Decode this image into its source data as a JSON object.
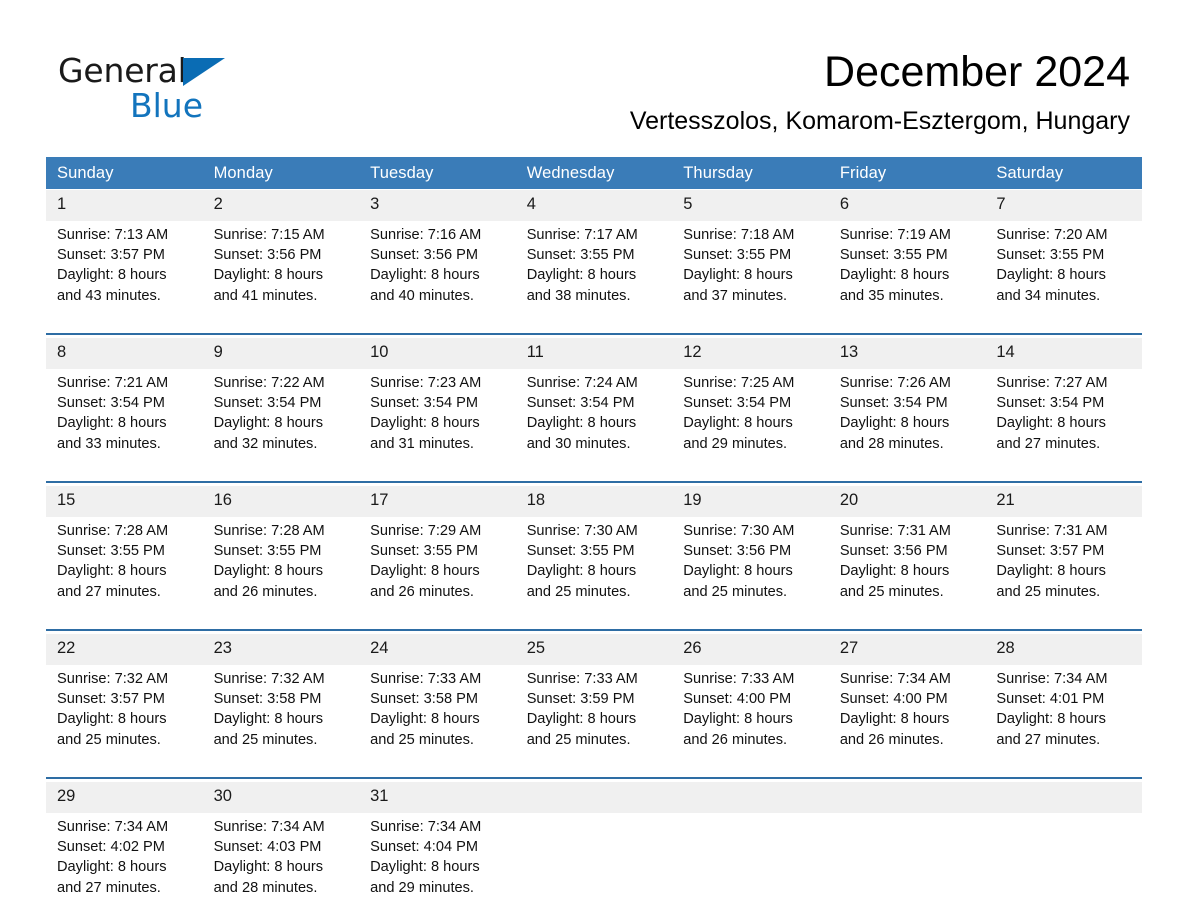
{
  "brand": {
    "name_part1": "General",
    "name_part2": "Blue",
    "triangle_color": "#0a6cb4",
    "blue_text_color": "#1274bd"
  },
  "header": {
    "title": "December 2024",
    "subtitle": "Vertesszolos, Komarom-Esztergom, Hungary"
  },
  "theme": {
    "header_blue": "#3a7cb8",
    "rule_blue": "#2e6da4",
    "daynum_band": "#f0f0f0"
  },
  "weekdays": [
    "Sunday",
    "Monday",
    "Tuesday",
    "Wednesday",
    "Thursday",
    "Friday",
    "Saturday"
  ],
  "weeks": [
    {
      "days": [
        {
          "num": "1",
          "sunrise": "Sunrise: 7:13 AM",
          "sunset": "Sunset: 3:57 PM",
          "daylight1": "Daylight: 8 hours",
          "daylight2": "and 43 minutes."
        },
        {
          "num": "2",
          "sunrise": "Sunrise: 7:15 AM",
          "sunset": "Sunset: 3:56 PM",
          "daylight1": "Daylight: 8 hours",
          "daylight2": "and 41 minutes."
        },
        {
          "num": "3",
          "sunrise": "Sunrise: 7:16 AM",
          "sunset": "Sunset: 3:56 PM",
          "daylight1": "Daylight: 8 hours",
          "daylight2": "and 40 minutes."
        },
        {
          "num": "4",
          "sunrise": "Sunrise: 7:17 AM",
          "sunset": "Sunset: 3:55 PM",
          "daylight1": "Daylight: 8 hours",
          "daylight2": "and 38 minutes."
        },
        {
          "num": "5",
          "sunrise": "Sunrise: 7:18 AM",
          "sunset": "Sunset: 3:55 PM",
          "daylight1": "Daylight: 8 hours",
          "daylight2": "and 37 minutes."
        },
        {
          "num": "6",
          "sunrise": "Sunrise: 7:19 AM",
          "sunset": "Sunset: 3:55 PM",
          "daylight1": "Daylight: 8 hours",
          "daylight2": "and 35 minutes."
        },
        {
          "num": "7",
          "sunrise": "Sunrise: 7:20 AM",
          "sunset": "Sunset: 3:55 PM",
          "daylight1": "Daylight: 8 hours",
          "daylight2": "and 34 minutes."
        }
      ]
    },
    {
      "days": [
        {
          "num": "8",
          "sunrise": "Sunrise: 7:21 AM",
          "sunset": "Sunset: 3:54 PM",
          "daylight1": "Daylight: 8 hours",
          "daylight2": "and 33 minutes."
        },
        {
          "num": "9",
          "sunrise": "Sunrise: 7:22 AM",
          "sunset": "Sunset: 3:54 PM",
          "daylight1": "Daylight: 8 hours",
          "daylight2": "and 32 minutes."
        },
        {
          "num": "10",
          "sunrise": "Sunrise: 7:23 AM",
          "sunset": "Sunset: 3:54 PM",
          "daylight1": "Daylight: 8 hours",
          "daylight2": "and 31 minutes."
        },
        {
          "num": "11",
          "sunrise": "Sunrise: 7:24 AM",
          "sunset": "Sunset: 3:54 PM",
          "daylight1": "Daylight: 8 hours",
          "daylight2": "and 30 minutes."
        },
        {
          "num": "12",
          "sunrise": "Sunrise: 7:25 AM",
          "sunset": "Sunset: 3:54 PM",
          "daylight1": "Daylight: 8 hours",
          "daylight2": "and 29 minutes."
        },
        {
          "num": "13",
          "sunrise": "Sunrise: 7:26 AM",
          "sunset": "Sunset: 3:54 PM",
          "daylight1": "Daylight: 8 hours",
          "daylight2": "and 28 minutes."
        },
        {
          "num": "14",
          "sunrise": "Sunrise: 7:27 AM",
          "sunset": "Sunset: 3:54 PM",
          "daylight1": "Daylight: 8 hours",
          "daylight2": "and 27 minutes."
        }
      ]
    },
    {
      "days": [
        {
          "num": "15",
          "sunrise": "Sunrise: 7:28 AM",
          "sunset": "Sunset: 3:55 PM",
          "daylight1": "Daylight: 8 hours",
          "daylight2": "and 27 minutes."
        },
        {
          "num": "16",
          "sunrise": "Sunrise: 7:28 AM",
          "sunset": "Sunset: 3:55 PM",
          "daylight1": "Daylight: 8 hours",
          "daylight2": "and 26 minutes."
        },
        {
          "num": "17",
          "sunrise": "Sunrise: 7:29 AM",
          "sunset": "Sunset: 3:55 PM",
          "daylight1": "Daylight: 8 hours",
          "daylight2": "and 26 minutes."
        },
        {
          "num": "18",
          "sunrise": "Sunrise: 7:30 AM",
          "sunset": "Sunset: 3:55 PM",
          "daylight1": "Daylight: 8 hours",
          "daylight2": "and 25 minutes."
        },
        {
          "num": "19",
          "sunrise": "Sunrise: 7:30 AM",
          "sunset": "Sunset: 3:56 PM",
          "daylight1": "Daylight: 8 hours",
          "daylight2": "and 25 minutes."
        },
        {
          "num": "20",
          "sunrise": "Sunrise: 7:31 AM",
          "sunset": "Sunset: 3:56 PM",
          "daylight1": "Daylight: 8 hours",
          "daylight2": "and 25 minutes."
        },
        {
          "num": "21",
          "sunrise": "Sunrise: 7:31 AM",
          "sunset": "Sunset: 3:57 PM",
          "daylight1": "Daylight: 8 hours",
          "daylight2": "and 25 minutes."
        }
      ]
    },
    {
      "days": [
        {
          "num": "22",
          "sunrise": "Sunrise: 7:32 AM",
          "sunset": "Sunset: 3:57 PM",
          "daylight1": "Daylight: 8 hours",
          "daylight2": "and 25 minutes."
        },
        {
          "num": "23",
          "sunrise": "Sunrise: 7:32 AM",
          "sunset": "Sunset: 3:58 PM",
          "daylight1": "Daylight: 8 hours",
          "daylight2": "and 25 minutes."
        },
        {
          "num": "24",
          "sunrise": "Sunrise: 7:33 AM",
          "sunset": "Sunset: 3:58 PM",
          "daylight1": "Daylight: 8 hours",
          "daylight2": "and 25 minutes."
        },
        {
          "num": "25",
          "sunrise": "Sunrise: 7:33 AM",
          "sunset": "Sunset: 3:59 PM",
          "daylight1": "Daylight: 8 hours",
          "daylight2": "and 25 minutes."
        },
        {
          "num": "26",
          "sunrise": "Sunrise: 7:33 AM",
          "sunset": "Sunset: 4:00 PM",
          "daylight1": "Daylight: 8 hours",
          "daylight2": "and 26 minutes."
        },
        {
          "num": "27",
          "sunrise": "Sunrise: 7:34 AM",
          "sunset": "Sunset: 4:00 PM",
          "daylight1": "Daylight: 8 hours",
          "daylight2": "and 26 minutes."
        },
        {
          "num": "28",
          "sunrise": "Sunrise: 7:34 AM",
          "sunset": "Sunset: 4:01 PM",
          "daylight1": "Daylight: 8 hours",
          "daylight2": "and 27 minutes."
        }
      ]
    },
    {
      "days": [
        {
          "num": "29",
          "sunrise": "Sunrise: 7:34 AM",
          "sunset": "Sunset: 4:02 PM",
          "daylight1": "Daylight: 8 hours",
          "daylight2": "and 27 minutes."
        },
        {
          "num": "30",
          "sunrise": "Sunrise: 7:34 AM",
          "sunset": "Sunset: 4:03 PM",
          "daylight1": "Daylight: 8 hours",
          "daylight2": "and 28 minutes."
        },
        {
          "num": "31",
          "sunrise": "Sunrise: 7:34 AM",
          "sunset": "Sunset: 4:04 PM",
          "daylight1": "Daylight: 8 hours",
          "daylight2": "and 29 minutes."
        },
        {
          "num": "",
          "sunrise": "",
          "sunset": "",
          "daylight1": "",
          "daylight2": ""
        },
        {
          "num": "",
          "sunrise": "",
          "sunset": "",
          "daylight1": "",
          "daylight2": ""
        },
        {
          "num": "",
          "sunrise": "",
          "sunset": "",
          "daylight1": "",
          "daylight2": ""
        },
        {
          "num": "",
          "sunrise": "",
          "sunset": "",
          "daylight1": "",
          "daylight2": ""
        }
      ]
    }
  ]
}
